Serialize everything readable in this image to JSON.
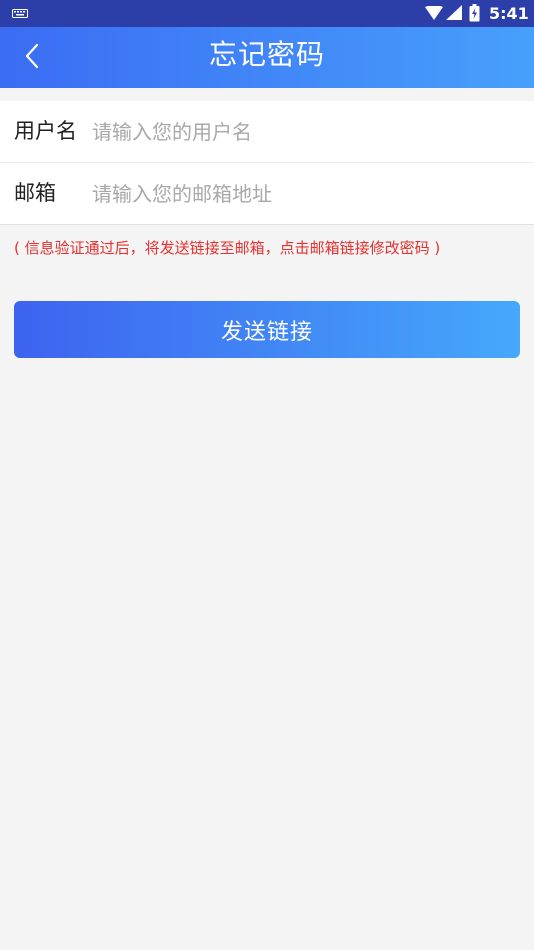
{
  "status_bar": {
    "time": "5:41",
    "icons": [
      "keyboard-icon",
      "wifi-icon",
      "cell-signal-icon",
      "battery-icon"
    ]
  },
  "app_bar": {
    "title": "忘记密码",
    "back_icon": "chevron-left-icon"
  },
  "form": {
    "username": {
      "label": "用户名",
      "placeholder": "请输入您的用户名",
      "value": ""
    },
    "email": {
      "label": "邮箱",
      "placeholder": "请输入您的邮箱地址",
      "value": ""
    }
  },
  "hint": "( 信息验证通过后，将发送链接至邮箱，点击邮箱链接修改密码 )",
  "send_button": {
    "label": "发送链接"
  },
  "colors": {
    "status_bar": "#2c3fa8",
    "app_bar_start": "#3b6cf4",
    "app_bar_end": "#47a0fb",
    "button_start": "#3d63ef",
    "button_end": "#45a8fb",
    "hint_text": "#e8302e",
    "page_background": "#f4f4f4"
  }
}
